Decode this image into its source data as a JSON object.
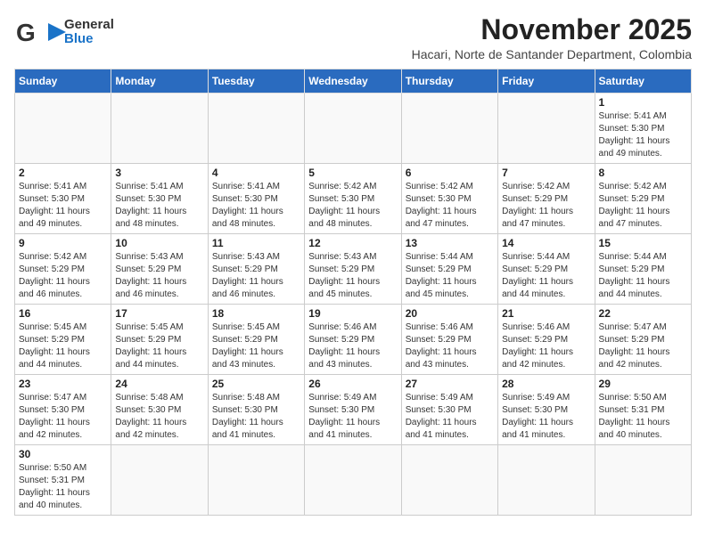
{
  "header": {
    "logo_line1": "General",
    "logo_line2": "Blue",
    "month_title": "November 2025",
    "location": "Hacari, Norte de Santander Department, Colombia"
  },
  "days_of_week": [
    "Sunday",
    "Monday",
    "Tuesday",
    "Wednesday",
    "Thursday",
    "Friday",
    "Saturday"
  ],
  "weeks": [
    [
      {
        "day": "",
        "info": ""
      },
      {
        "day": "",
        "info": ""
      },
      {
        "day": "",
        "info": ""
      },
      {
        "day": "",
        "info": ""
      },
      {
        "day": "",
        "info": ""
      },
      {
        "day": "",
        "info": ""
      },
      {
        "day": "1",
        "info": "Sunrise: 5:41 AM\nSunset: 5:30 PM\nDaylight: 11 hours\nand 49 minutes."
      }
    ],
    [
      {
        "day": "2",
        "info": "Sunrise: 5:41 AM\nSunset: 5:30 PM\nDaylight: 11 hours\nand 49 minutes."
      },
      {
        "day": "3",
        "info": "Sunrise: 5:41 AM\nSunset: 5:30 PM\nDaylight: 11 hours\nand 48 minutes."
      },
      {
        "day": "4",
        "info": "Sunrise: 5:41 AM\nSunset: 5:30 PM\nDaylight: 11 hours\nand 48 minutes."
      },
      {
        "day": "5",
        "info": "Sunrise: 5:42 AM\nSunset: 5:30 PM\nDaylight: 11 hours\nand 48 minutes."
      },
      {
        "day": "6",
        "info": "Sunrise: 5:42 AM\nSunset: 5:30 PM\nDaylight: 11 hours\nand 47 minutes."
      },
      {
        "day": "7",
        "info": "Sunrise: 5:42 AM\nSunset: 5:29 PM\nDaylight: 11 hours\nand 47 minutes."
      },
      {
        "day": "8",
        "info": "Sunrise: 5:42 AM\nSunset: 5:29 PM\nDaylight: 11 hours\nand 47 minutes."
      }
    ],
    [
      {
        "day": "9",
        "info": "Sunrise: 5:42 AM\nSunset: 5:29 PM\nDaylight: 11 hours\nand 46 minutes."
      },
      {
        "day": "10",
        "info": "Sunrise: 5:43 AM\nSunset: 5:29 PM\nDaylight: 11 hours\nand 46 minutes."
      },
      {
        "day": "11",
        "info": "Sunrise: 5:43 AM\nSunset: 5:29 PM\nDaylight: 11 hours\nand 46 minutes."
      },
      {
        "day": "12",
        "info": "Sunrise: 5:43 AM\nSunset: 5:29 PM\nDaylight: 11 hours\nand 45 minutes."
      },
      {
        "day": "13",
        "info": "Sunrise: 5:44 AM\nSunset: 5:29 PM\nDaylight: 11 hours\nand 45 minutes."
      },
      {
        "day": "14",
        "info": "Sunrise: 5:44 AM\nSunset: 5:29 PM\nDaylight: 11 hours\nand 44 minutes."
      },
      {
        "day": "15",
        "info": "Sunrise: 5:44 AM\nSunset: 5:29 PM\nDaylight: 11 hours\nand 44 minutes."
      }
    ],
    [
      {
        "day": "16",
        "info": "Sunrise: 5:45 AM\nSunset: 5:29 PM\nDaylight: 11 hours\nand 44 minutes."
      },
      {
        "day": "17",
        "info": "Sunrise: 5:45 AM\nSunset: 5:29 PM\nDaylight: 11 hours\nand 44 minutes."
      },
      {
        "day": "18",
        "info": "Sunrise: 5:45 AM\nSunset: 5:29 PM\nDaylight: 11 hours\nand 43 minutes."
      },
      {
        "day": "19",
        "info": "Sunrise: 5:46 AM\nSunset: 5:29 PM\nDaylight: 11 hours\nand 43 minutes."
      },
      {
        "day": "20",
        "info": "Sunrise: 5:46 AM\nSunset: 5:29 PM\nDaylight: 11 hours\nand 43 minutes."
      },
      {
        "day": "21",
        "info": "Sunrise: 5:46 AM\nSunset: 5:29 PM\nDaylight: 11 hours\nand 42 minutes."
      },
      {
        "day": "22",
        "info": "Sunrise: 5:47 AM\nSunset: 5:29 PM\nDaylight: 11 hours\nand 42 minutes."
      }
    ],
    [
      {
        "day": "23",
        "info": "Sunrise: 5:47 AM\nSunset: 5:30 PM\nDaylight: 11 hours\nand 42 minutes."
      },
      {
        "day": "24",
        "info": "Sunrise: 5:48 AM\nSunset: 5:30 PM\nDaylight: 11 hours\nand 42 minutes."
      },
      {
        "day": "25",
        "info": "Sunrise: 5:48 AM\nSunset: 5:30 PM\nDaylight: 11 hours\nand 41 minutes."
      },
      {
        "day": "26",
        "info": "Sunrise: 5:49 AM\nSunset: 5:30 PM\nDaylight: 11 hours\nand 41 minutes."
      },
      {
        "day": "27",
        "info": "Sunrise: 5:49 AM\nSunset: 5:30 PM\nDaylight: 11 hours\nand 41 minutes."
      },
      {
        "day": "28",
        "info": "Sunrise: 5:49 AM\nSunset: 5:30 PM\nDaylight: 11 hours\nand 41 minutes."
      },
      {
        "day": "29",
        "info": "Sunrise: 5:50 AM\nSunset: 5:31 PM\nDaylight: 11 hours\nand 40 minutes."
      }
    ],
    [
      {
        "day": "30",
        "info": "Sunrise: 5:50 AM\nSunset: 5:31 PM\nDaylight: 11 hours\nand 40 minutes."
      },
      {
        "day": "",
        "info": ""
      },
      {
        "day": "",
        "info": ""
      },
      {
        "day": "",
        "info": ""
      },
      {
        "day": "",
        "info": ""
      },
      {
        "day": "",
        "info": ""
      },
      {
        "day": "",
        "info": ""
      }
    ]
  ]
}
